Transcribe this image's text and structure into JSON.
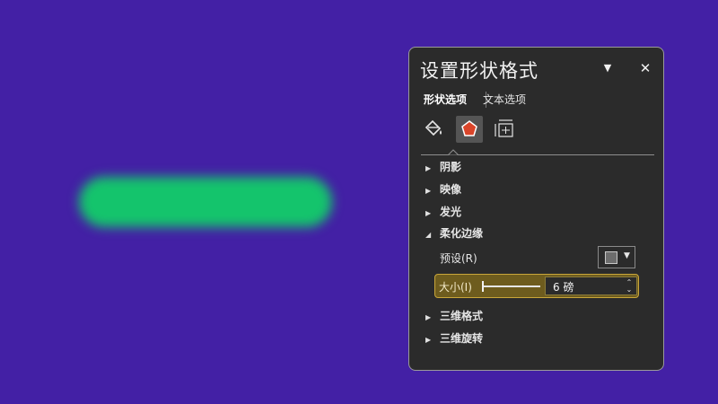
{
  "panel": {
    "title": "设置形状格式",
    "tabs": {
      "shape": "形状选项",
      "text": "文本选项"
    },
    "sections": {
      "shadow": "阴影",
      "reflection": "映像",
      "glow": "发光",
      "soft_edges": "柔化边缘",
      "format_3d": "三维格式",
      "rotation_3d": "三维旋转"
    },
    "soft_edges": {
      "preset_label": "预设(R)",
      "size_label": "大小(I)",
      "size_value": "6 磅",
      "size_fraction": 0.0
    },
    "icons": {
      "dropdown": "chevron-down-icon",
      "close": "close-icon",
      "fill_line": "paint-bucket-icon",
      "effects": "pentagon-icon",
      "size_props": "size-properties-icon"
    }
  },
  "colors": {
    "background": "#4320a5",
    "shape": "#14c46c",
    "panel": "#2b2b2b",
    "highlight": "#6e5c1e",
    "effects_icon": "#d9452a"
  }
}
